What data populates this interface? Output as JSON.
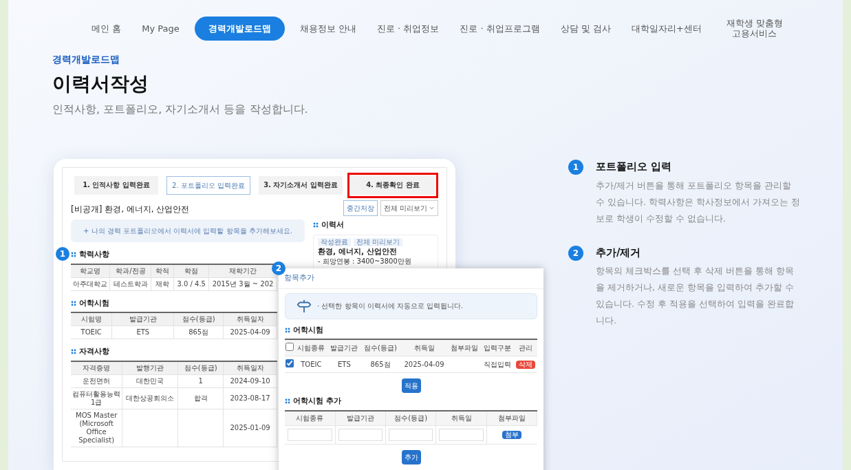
{
  "nav": [
    {
      "label": "메인 홈",
      "selected": false
    },
    {
      "label": "My Page",
      "selected": false
    },
    {
      "label": "경력개발로드맵",
      "selected": true
    },
    {
      "label": "채용정보 안내",
      "selected": false
    },
    {
      "label": "진로 · 취업정보",
      "selected": false
    },
    {
      "label": "진로 · 취업프로그램",
      "selected": false
    },
    {
      "label": "상담 및 검사",
      "selected": false
    },
    {
      "label": "대학일자리+센터",
      "selected": false
    },
    {
      "label": "재학생 맞춤형 고용서비스",
      "selected": false
    }
  ],
  "header": {
    "breadcrumb": "경력개발로드맵",
    "title": "이력서작성",
    "subtitle": "인적사항, 포트폴리오, 자기소개서 등을 작성합니다."
  },
  "preview": {
    "steps": [
      {
        "label": "1. 인적사항 입력완료",
        "selected": false,
        "highlighted": false
      },
      {
        "label": "2. 포트폴리오 입력완료",
        "selected": true,
        "highlighted": false
      },
      {
        "label": "3. 자기소개서 입력완료",
        "selected": false,
        "highlighted": false
      },
      {
        "label": "4. 최종확인 완료",
        "selected": false,
        "highlighted": true
      }
    ],
    "resume_title": "[비공개] 환경, 에너지, 산업안전",
    "save_button": "중간저장",
    "preview_button": "전체 미리보기",
    "banner": "+ 나의 경력 포트폴리오에서 이력서에 입력할 항목을 추가해보세요.",
    "sections": [
      {
        "marker": "1",
        "title": "학력사항",
        "columns": [
          "학교명",
          "학과/전공",
          "학적",
          "학점",
          "재학기간"
        ],
        "rows": [
          [
            "아주대학교",
            "테스트학과",
            "재학",
            "3.0 / 4.5",
            "2015년 3월 ~ 202"
          ]
        ]
      },
      {
        "title": "어학시험",
        "columns": [
          "시험명",
          "발급기관",
          "점수(등급)",
          "취득일자"
        ],
        "rows": [
          [
            "TOEIC",
            "ETS",
            "865점",
            "2025-04-09"
          ]
        ]
      },
      {
        "title": "자격사항",
        "columns": [
          "자격증명",
          "발행기관",
          "점수(등급)",
          "취득일자"
        ],
        "rows": [
          [
            "운전면허",
            "대한민국",
            "1",
            "2024-09-10"
          ],
          [
            "컴퓨터활용능력 1급",
            "대한상공회의소",
            "합격",
            "2023-08-17"
          ],
          [
            "MOS Master (Microsoft Office Specialist)",
            null,
            null,
            "2025-01-09"
          ]
        ]
      }
    ],
    "resume_card": {
      "heading": "이력서",
      "tags": [
        "작성완료",
        "전체 미리보기"
      ],
      "title": "환경, 에너지, 산업안전",
      "lines": [
        "- 희망연봉 : 3400~3800만원"
      ]
    },
    "popup": {
      "marker": "2",
      "title": "항목추가",
      "notice": "· 선택한 항목이 이력서에 자동으로 입력됩니다.",
      "list_title": "어학시험",
      "columns": [
        "시험종류",
        "발급기관",
        "점수(등급)",
        "취득일",
        "첨부파일",
        "입력구분",
        "관리"
      ],
      "header_checked": false,
      "rows": [
        {
          "checked": true,
          "cells": [
            "TOEIC",
            "ETS",
            "865점",
            "2025-04-09",
            null,
            "직접입력"
          ],
          "action": "삭제"
        }
      ],
      "apply_button": "적용",
      "add_title": "어학시험 추가",
      "add_columns": [
        "시험종류",
        "발급기관",
        "점수(등급)",
        "취득일",
        "첨부파일"
      ],
      "attach_button": "첨부",
      "add_button": "추가"
    }
  },
  "explanations": [
    {
      "number": "1",
      "title": "포트폴리오 입력",
      "text": "추가/제거 버튼을 통해 포트폴리오 항목을 관리할 수 있습니다. 학력사항은 학사정보에서 가져오는 정보로 학생이 수정할 수 없습니다."
    },
    {
      "number": "2",
      "title": "추가/제거",
      "text": "항목의 체크박스를 선택 후 삭제 버튼을 통해 항목을 제거하거나, 새로운 항목을 입력하여 추가할 수 있습니다. 수정 후 적용을 선택하여 입력을 완료합니다."
    }
  ]
}
